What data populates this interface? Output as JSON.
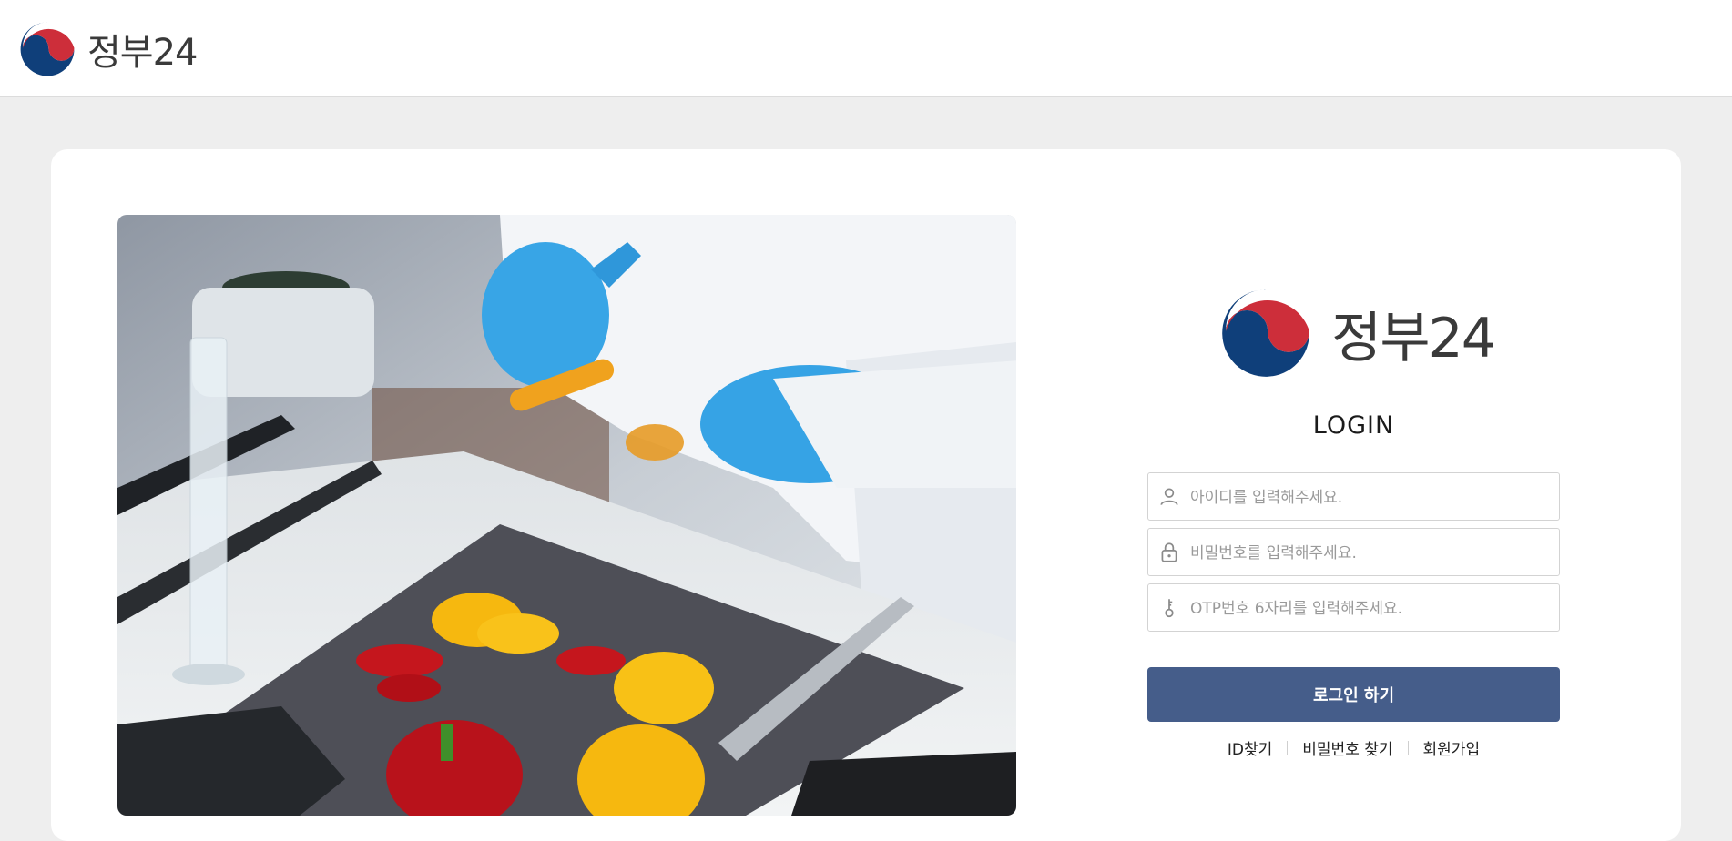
{
  "header": {
    "logo_text": "정부24"
  },
  "login": {
    "logo_text": "정부24",
    "title": "LOGIN",
    "id_placeholder": "아이디를 입력해주세요.",
    "password_placeholder": "비밀번호를 입력해주세요.",
    "otp_placeholder": "OTP번호 6자리를 입력해주세요.",
    "submit_label": "로그인 하기",
    "links": {
      "find_id": "ID찾기",
      "find_password": "비밀번호 찾기",
      "signup": "회원가입"
    }
  },
  "colors": {
    "brand_blue": "#0f3f7a",
    "brand_red": "#cd2e3a",
    "button": "#455d8a",
    "page_bg": "#eeeeee"
  },
  "icons": {
    "logo": "taegeuk-logo-icon",
    "id_field": "user-icon",
    "password_field": "lock-icon",
    "otp_field": "key-icon"
  }
}
